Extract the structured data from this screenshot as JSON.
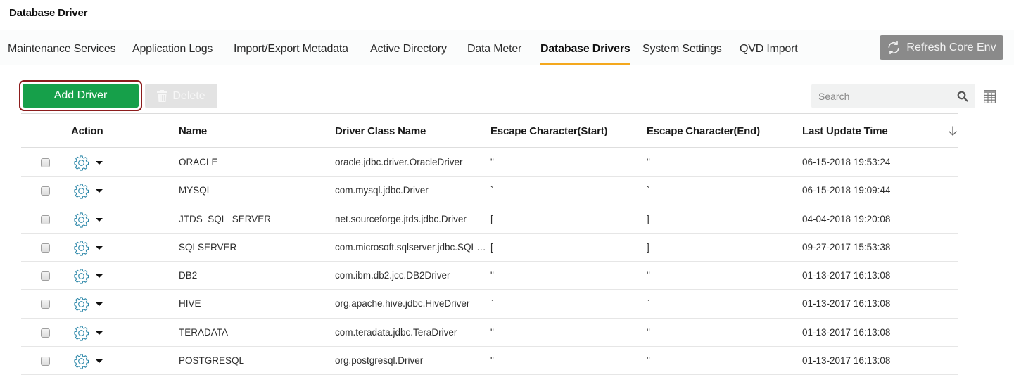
{
  "page": {
    "title": "Database Driver"
  },
  "tabs": [
    {
      "label": "Maintenance Services",
      "active": false
    },
    {
      "label": "Application Logs",
      "active": false
    },
    {
      "label": "Import/Export Metadata",
      "active": false
    },
    {
      "label": "Active Directory",
      "active": false
    },
    {
      "label": "Data Meter",
      "active": false
    },
    {
      "label": "Database Drivers",
      "active": true
    },
    {
      "label": "System Settings",
      "active": false
    },
    {
      "label": "QVD Import",
      "active": false
    }
  ],
  "toolbar": {
    "refresh_label": "Refresh Core Env",
    "add_label": "Add Driver",
    "delete_label": "Delete",
    "search_placeholder": "Search",
    "search_value": ""
  },
  "colors": {
    "accent_tab": "#f4a81d",
    "add_button": "#16a04a",
    "add_button_outline": "#8c1c1c",
    "gear_icon": "#2a86a8",
    "refresh_button": "#8a8a8a"
  },
  "table": {
    "columns": {
      "action": "Action",
      "name": "Name",
      "driver_class": "Driver Class Name",
      "escape_start": "Escape Character(Start)",
      "escape_end": "Escape Character(End)",
      "last_update": "Last Update Time"
    },
    "sort": {
      "column": "last_update",
      "direction": "descending"
    },
    "rows": [
      {
        "name": "ORACLE",
        "driver_class": "oracle.jdbc.driver.OracleDriver",
        "escape_start": "\"",
        "escape_end": "\"",
        "last_update": "06-15-2018 19:53:24",
        "checked": false
      },
      {
        "name": "MYSQL",
        "driver_class": "com.mysql.jdbc.Driver",
        "escape_start": "`",
        "escape_end": "`",
        "last_update": "06-15-2018 19:09:44",
        "checked": false
      },
      {
        "name": "JTDS_SQL_SERVER",
        "driver_class": "net.sourceforge.jtds.jdbc.Driver",
        "escape_start": "[",
        "escape_end": "]",
        "last_update": "04-04-2018 19:20:08",
        "checked": false
      },
      {
        "name": "SQLSERVER",
        "driver_class": "com.microsoft.sqlserver.jdbc.SQLS…",
        "escape_start": "[",
        "escape_end": "]",
        "last_update": "09-27-2017 15:53:38",
        "checked": false
      },
      {
        "name": "DB2",
        "driver_class": "com.ibm.db2.jcc.DB2Driver",
        "escape_start": "\"",
        "escape_end": "\"",
        "last_update": "01-13-2017 16:13:08",
        "checked": false
      },
      {
        "name": "HIVE",
        "driver_class": "org.apache.hive.jdbc.HiveDriver",
        "escape_start": "`",
        "escape_end": "`",
        "last_update": "01-13-2017 16:13:08",
        "checked": false
      },
      {
        "name": "TERADATA",
        "driver_class": "com.teradata.jdbc.TeraDriver",
        "escape_start": "\"",
        "escape_end": "\"",
        "last_update": "01-13-2017 16:13:08",
        "checked": false
      },
      {
        "name": "POSTGRESQL",
        "driver_class": "org.postgresql.Driver",
        "escape_start": "\"",
        "escape_end": "\"",
        "last_update": "01-13-2017 16:13:08",
        "checked": false
      }
    ]
  }
}
